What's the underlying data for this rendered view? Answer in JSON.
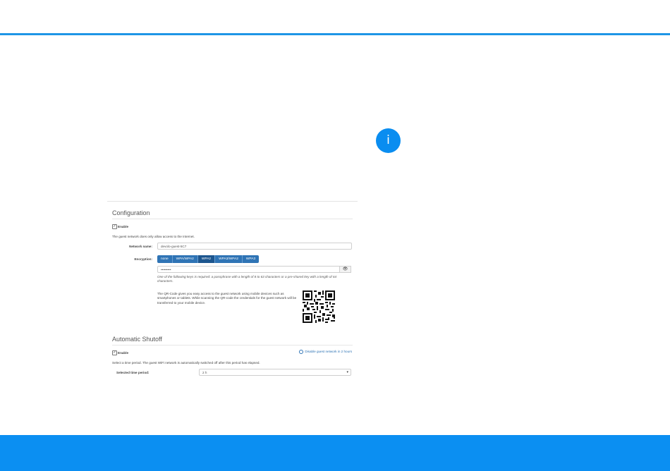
{
  "info_icon": "i",
  "configuration": {
    "title": "Configuration",
    "enable_label": "Enable",
    "enable_checked": true,
    "note": "The guest network does only allow access to the Internet.",
    "network_name_label": "Network name:",
    "network_name_value": "devolo-guest-5C7",
    "encryption_label": "Encryption:",
    "encryption_options": [
      "none",
      "WPA/WPA2",
      "WPA2",
      "WPA3/WPA2",
      "WPA3"
    ],
    "encryption_selected": "WPA2",
    "key_value": "•••••••••",
    "key_hint": "One of the following keys is required: a passphrase with a length of 8 to 63 characters or a pre-shared key with a length of 64 characters.",
    "qr_text": "The QR-Code gives you easy access to the guest network using mobile devices such as smartphones or tablets. While scanning the QR-code the credentials for the guest network will be transferred to your mobile device."
  },
  "shutoff": {
    "title": "Automatic Shutoff",
    "enable_label": "Enable",
    "enable_checked": true,
    "disable_link": "Disable guest network in 2 hours",
    "description": "Select a time period. The guest WiFi network is automatically switched off after this period has elapsed.",
    "period_label": "Selected time period:",
    "period_value": "2 h"
  },
  "icons": {
    "info": "info-icon",
    "eye": "eye-icon",
    "clock": "clock-icon",
    "caret": "chevron-down-icon",
    "check": "checkmark-icon"
  },
  "colors": {
    "accent": "#1e95e6",
    "footer": "#0b8ff2",
    "button": "#2f74b5",
    "button_active": "#1d568f"
  }
}
